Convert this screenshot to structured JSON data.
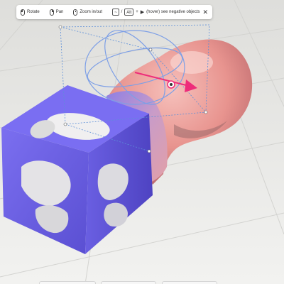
{
  "toolbar": {
    "rotate_label": "Rotate",
    "pan_label": "Pan",
    "zoom_label": "Zoom in/out",
    "tilde_key": "~",
    "slash": "/",
    "alt_key": "Alt",
    "plus": "+",
    "hover_hint": "(hover) see negative objects",
    "close_label": "✕"
  },
  "icons": {
    "rotate": "mouse-left-icon",
    "pan": "mouse-right-icon",
    "zoom": "mouse-wheel-icon",
    "hover": "cursor-icon"
  },
  "colors": {
    "cube": "#6e63e6",
    "bulb": "#e99a9a",
    "floor": "#e9e9e7",
    "gizmo_arrow": "#ee2d7a",
    "gizmo_ring": "#7d9fe6"
  }
}
